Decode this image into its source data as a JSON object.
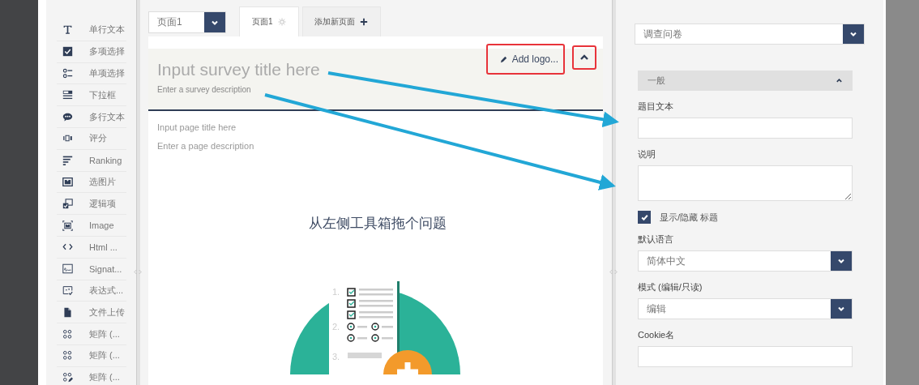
{
  "toolbox": {
    "items": [
      {
        "kind": "text",
        "label": "单行文本"
      },
      {
        "kind": "checkbox",
        "label": "多项选择"
      },
      {
        "kind": "radiogroup",
        "label": "单项选择"
      },
      {
        "kind": "dropdown",
        "label": "下拉框"
      },
      {
        "kind": "comment",
        "label": "多行文本"
      },
      {
        "kind": "rating",
        "label": "评分"
      },
      {
        "kind": "ranking",
        "label": "Ranking"
      },
      {
        "kind": "imagepicker",
        "label": "选图片"
      },
      {
        "kind": "boolean",
        "label": "逻辑项"
      },
      {
        "kind": "image",
        "label": "Image"
      },
      {
        "kind": "html",
        "label": "Html ..."
      },
      {
        "kind": "signature",
        "label": "Signat..."
      },
      {
        "kind": "expression",
        "label": "表达式..."
      },
      {
        "kind": "file",
        "label": "文件上传"
      },
      {
        "kind": "matrix",
        "label": "矩阵 (..."
      },
      {
        "kind": "matrix",
        "label": "矩阵 (..."
      },
      {
        "kind": "matrixedit",
        "label": "矩阵 (..."
      }
    ]
  },
  "page_select": {
    "value": "页面1"
  },
  "tabs": [
    {
      "kind": "page",
      "label": "页面1",
      "selected": true
    },
    {
      "kind": "add",
      "label": "添加新页面",
      "selected": false
    }
  ],
  "survey": {
    "title_placeholder": "Input survey title here",
    "description_placeholder": "Enter a survey description",
    "add_logo": "Add logo...",
    "page_title_placeholder": "Input page title here",
    "page_description_placeholder": "Enter a page description",
    "empty_message": "从左侧工具箱拖个问题"
  },
  "illustration": {
    "numbers": [
      "1.",
      "2.",
      "3."
    ]
  },
  "properties": {
    "object_select": "调查问卷",
    "section": {
      "title": "一般",
      "expanded": true
    },
    "fields": [
      {
        "kind": "input",
        "label": "题目文本"
      },
      {
        "kind": "textarea",
        "label": "说明"
      },
      {
        "kind": "checkbox",
        "label": "显示/隐藏 标题",
        "checked": true
      },
      {
        "kind": "select",
        "label": "默认语言",
        "value": "简体中文"
      },
      {
        "kind": "select",
        "label": "模式 (编辑/只读)",
        "value": "编辑"
      },
      {
        "kind": "input",
        "label": "Cookie名"
      }
    ]
  }
}
